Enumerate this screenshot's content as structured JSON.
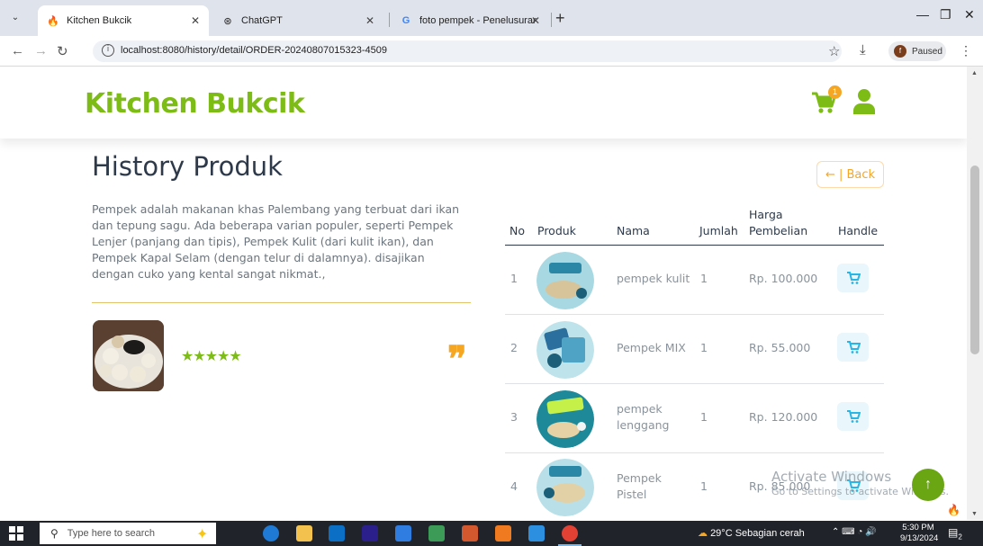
{
  "browser": {
    "tabs": [
      {
        "title": "Kitchen Bukcik",
        "active": true
      },
      {
        "title": "ChatGPT",
        "active": false
      },
      {
        "title": "foto pempek - Penelusuran Goo",
        "active": false
      }
    ],
    "url": "localhost:8080/history/detail/ORDER-20240807015323-4509",
    "profile_status": "Paused",
    "profile_initial": "f"
  },
  "header": {
    "brand": "Kitchen Bukcik",
    "cart_count": "1",
    "brand_color": "#7dbb16",
    "badge_color": "#f5a623"
  },
  "main": {
    "title": "History Produk",
    "description": "Pempek adalah makanan khas Palembang yang terbuat dari ikan dan tepung sagu. Ada beberapa varian populer, seperti Pempek Lenjer (panjang dan tipis), Pempek Kulit (dari kulit ikan), dan Pempek Kapal Selam (dengan telur di dalamnya). disajikan dengan cuko yang kental sangat nikmat.,",
    "rating_stars": "★★★★★",
    "back_label": "← | Back"
  },
  "table": {
    "headers": {
      "no": "No",
      "produk": "Produk",
      "nama": "Nama",
      "jumlah": "Jumlah",
      "harga_line1": "Harga",
      "harga_line2": "Pembelian",
      "handle": "Handle"
    },
    "rows": [
      {
        "no": "1",
        "nama": "pempek kulit",
        "jumlah": "1",
        "harga": "Rp. 100.000"
      },
      {
        "no": "2",
        "nama": "Pempek MIX",
        "jumlah": "1",
        "harga": "Rp. 55.000"
      },
      {
        "no": "3",
        "nama": "pempek lenggang",
        "jumlah": "1",
        "harga": "Rp. 120.000"
      },
      {
        "no": "4",
        "nama": "Pempek Pistel",
        "jumlah": "1",
        "harga": "Rp. 85.000"
      }
    ]
  },
  "watermark": {
    "line1": "Activate Windows",
    "line2": "Go to Settings to activate Windows."
  },
  "taskbar": {
    "search_placeholder": "Type here to search",
    "weather": "29°C  Sebagian cerah",
    "time": "5:30 PM",
    "date": "9/13/2024",
    "notif_count": "2"
  }
}
